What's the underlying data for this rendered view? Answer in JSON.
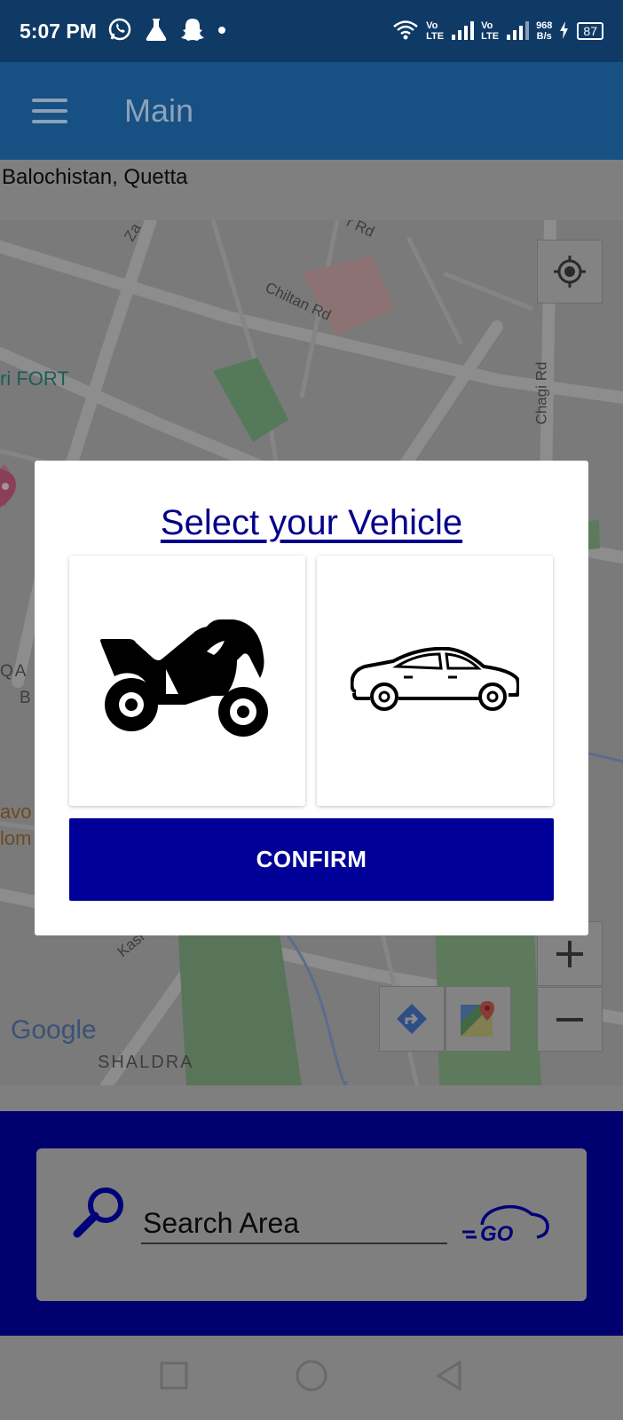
{
  "status_bar": {
    "time": "5:07 PM",
    "lte1_top": "Vo",
    "lte1_bottom": "LTE",
    "lte2_top": "Vo",
    "lte2_bottom": "LTE",
    "speed_value": "968",
    "speed_unit": "B/s",
    "battery": "87"
  },
  "app_bar": {
    "title": "Main"
  },
  "location": {
    "text": "Balochistan, Quetta"
  },
  "map": {
    "labels": {
      "road_top": "Za",
      "road_top2": "r Rd",
      "chiltan": "Chiltan Rd",
      "fort": "ri FORT",
      "chagi": "Chagi Rd",
      "qa": "QA",
      "b": "B",
      "avo": "avo",
      "lom": "lom",
      "kasi": "Kasi Ro",
      "shaldra": "SHALDRA",
      "google": "Google"
    }
  },
  "dialog": {
    "title": "Select your Vehicle",
    "confirm_label": "CONFIRM"
  },
  "search": {
    "placeholder": "Search Area",
    "logo_text": "GO"
  },
  "colors": {
    "status_bar": "#0f3a66",
    "app_bar": "#175083",
    "dialog_title": "#00008b",
    "confirm_button": "#000099",
    "bottom_panel": "#00006f"
  }
}
